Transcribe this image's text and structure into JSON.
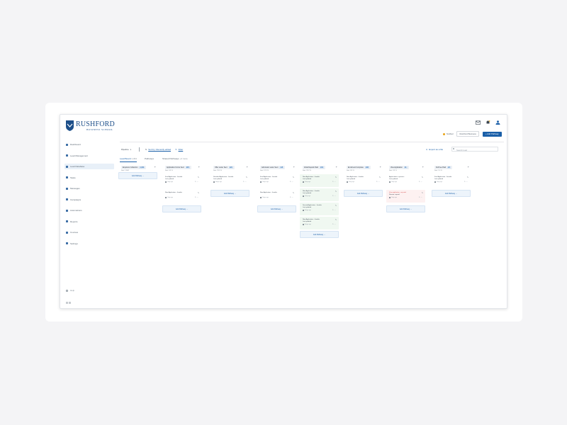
{
  "brand": {
    "title": "RUSHFORD",
    "subtitle": "BUSINESS SCHOOL",
    "color": "#1d4f8a"
  },
  "sidebar": {
    "items": [
      {
        "label": "Dashboard",
        "icon": "dashboard-icon"
      },
      {
        "label": "Lead Management",
        "icon": "user-icon"
      },
      {
        "label": "Lead Database",
        "icon": "database-icon",
        "active": true
      },
      {
        "label": "Tasks",
        "icon": "tasks-icon"
      },
      {
        "label": "Messages",
        "icon": "messages-icon"
      },
      {
        "label": "Campaigns",
        "icon": "campaign-icon"
      },
      {
        "label": "Automations",
        "icon": "automation-icon"
      },
      {
        "label": "Reports",
        "icon": "reports-icon"
      },
      {
        "label": "Courses",
        "icon": "courses-icon"
      },
      {
        "label": "Settings",
        "icon": "settings-icon"
      }
    ],
    "help": "Help"
  },
  "header": {
    "notify": "Notified",
    "school": "Rushford Business",
    "add_button": "+ Add Pathway"
  },
  "toolbar": {
    "pipeline": "Pipeline",
    "sort": "Sort by: Recently edited",
    "filter": "Filter",
    "export": "Export as a file",
    "search_placeholder": "Search lead"
  },
  "tabs": [
    {
      "label": "Lead Board",
      "count": "1,064",
      "active": true
    },
    {
      "label": "Pathways",
      "count": ""
    },
    {
      "label": "Shared Pathways",
      "count": "+4 more"
    }
  ],
  "columns": [
    {
      "title": "Enquirers Collection",
      "count": "1,064",
      "sub": "Sort: 1,064",
      "add_label": "Add Pathway  →",
      "cards": []
    },
    {
      "title": "Application Forms Sent",
      "count": "245",
      "sub": "Sort: 0.5 %",
      "add_label": "Add Pathway  →",
      "cards": [
        {
          "line1": "Final Application - Jennifer",
          "line2": "Last updated",
          "meta": "1 day ago",
          "tone": "white"
        },
        {
          "line1": "New Application - Jennifer",
          "line2": "",
          "meta": "1 day ago",
          "tone": "white"
        }
      ]
    },
    {
      "title": "Offer Letter Sent",
      "count": "120",
      "sub": "Sort: 25.5 %",
      "add_label": "Add Pathway  →",
      "cards": [
        {
          "line1": "Standard Application - Jennifer",
          "line2": "Last updated",
          "meta": "3 days ago",
          "tone": "white"
        }
      ]
    },
    {
      "title": "Admission Letter Sent",
      "count": "115",
      "sub": "Sort: 12.5 %",
      "add_label": "Add Pathway  →",
      "cards": [
        {
          "line1": "Final Application - Jennifer",
          "line2": "Last updated",
          "meta": "2 days ago",
          "tone": "white"
        },
        {
          "line1": "New Application - Jennifer",
          "line2": "",
          "meta": "2 days ago",
          "tone": "white"
        }
      ]
    },
    {
      "title": "Initial Deposit Paid",
      "count": "136",
      "sub": "Sort: 25.2 %",
      "add_label": "Add Pathway  →",
      "cards": [
        {
          "line1": "New Application - Jennifer",
          "line2": "Last updated",
          "meta": "1 day ago",
          "tone": "green"
        },
        {
          "line1": "New Application - Jennifer",
          "line2": "Last updated",
          "meta": "1 day ago",
          "tone": "green"
        },
        {
          "line1": "Second Application - Jennifer",
          "line2": "Last updated",
          "meta": "3 days ago",
          "tone": "green"
        },
        {
          "line1": "New Application - Jennifer",
          "line2": "Last updated",
          "meta": "3 days ago",
          "tone": "green"
        }
      ]
    },
    {
      "title": "Enrolment Complete",
      "count": "108",
      "sub": "Sort: 8.5 %",
      "add_label": "Add Pathway  →",
      "cards": [
        {
          "line1": "New Application - Jennifer",
          "line2": "Last updated",
          "meta": "1 day ago",
          "tone": "white"
        }
      ]
    },
    {
      "title": "Visa Application",
      "count": "41",
      "sub": "Sort: 3.5 %",
      "add_label": "Add Pathway  →",
      "cards": [
        {
          "line1": "Applications in process",
          "line2": "Last updated",
          "meta": "1 day ago",
          "tone": "white"
        },
        {
          "line1": "Visa application - rejected",
          "line2": "Reason: unpaid",
          "meta": "1 day ago",
          "tone": "red"
        }
      ]
    },
    {
      "title": "Full Fee Paid",
      "count": "20",
      "sub": "Sort: 1.0 %",
      "add_label": "Add Pathway  →",
      "cards": [
        {
          "line1": "Final Application - Jennifer",
          "line2": "Last updated",
          "meta": "1 day ago",
          "tone": "white"
        }
      ]
    }
  ]
}
